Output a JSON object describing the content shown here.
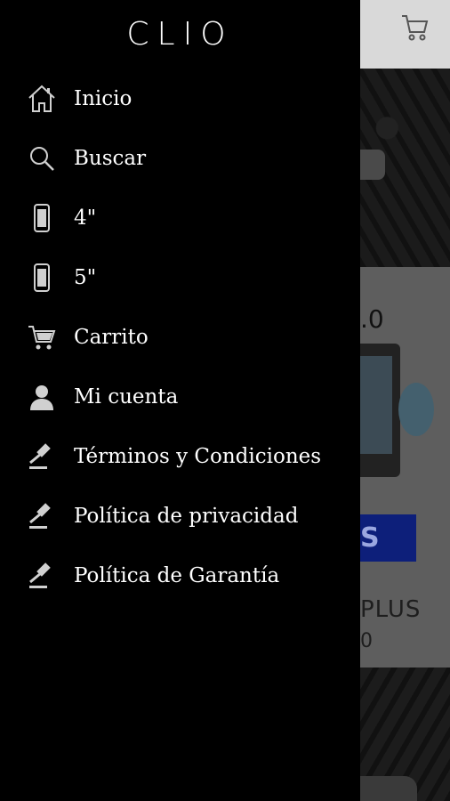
{
  "app": {
    "logo": "CLIO"
  },
  "menu": {
    "items": [
      {
        "label": "Inicio",
        "icon": "home-icon"
      },
      {
        "label": "Buscar",
        "icon": "search-icon"
      },
      {
        "label": "4\"",
        "icon": "phone-icon"
      },
      {
        "label": "5\"",
        "icon": "phone-icon"
      },
      {
        "label": "Carrito",
        "icon": "cart-icon"
      },
      {
        "label": "Mi cuenta",
        "icon": "user-icon"
      },
      {
        "label": "Términos y Condiciones",
        "icon": "gavel-icon"
      },
      {
        "label": "Política de privacidad",
        "icon": "gavel-icon"
      },
      {
        "label": "Política de Garantía",
        "icon": "gavel-icon"
      }
    ]
  },
  "background": {
    "price_fragment": ".0",
    "button_fragment": "S",
    "product_fragment": "PLUS",
    "sub_fragment": "0"
  },
  "colors": {
    "drawer_bg": "#000000",
    "text": "#ffffff",
    "icon": "#d0d0d0",
    "button": "#0d1f7a"
  }
}
